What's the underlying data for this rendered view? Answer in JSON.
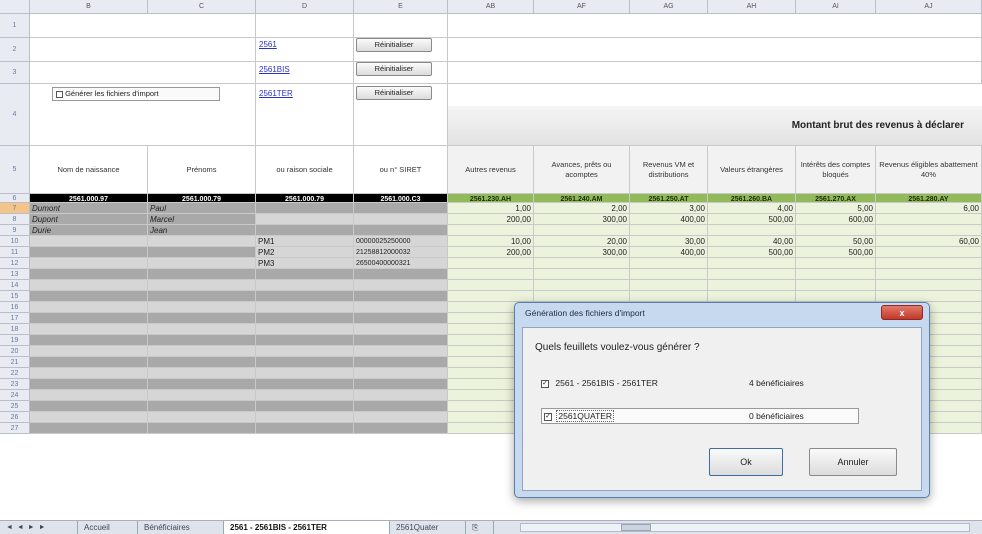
{
  "col_headers": [
    "B",
    "C",
    "D",
    "E",
    "AB",
    "AF",
    "AG",
    "AH",
    "AI",
    "AJ"
  ],
  "row_numbers": [
    "1",
    "2",
    "3",
    "4",
    "5",
    "6",
    "7",
    "8",
    "9",
    "10",
    "11",
    "12",
    "13",
    "14",
    "15",
    "16",
    "17",
    "18",
    "19",
    "20",
    "21",
    "22",
    "23",
    "24",
    "25",
    "26",
    "27"
  ],
  "top": {
    "link1": "2561",
    "link2": "2561BIS",
    "link3": "2561TER",
    "btn1": "Réinitialiser",
    "btn2": "Réinitialiser",
    "btn3": "Réinitialiser",
    "checkbox_label": "Générer les fichiers d'import",
    "montant_title": "Montant brut des revenus à déclarer"
  },
  "columns": {
    "c1": "Nom de naissance",
    "c2": "Prénoms",
    "c3": "ou raison sociale",
    "c4": "ou n° SIRET",
    "c5": "Autres revenus",
    "c6": "Avances, prêts ou acomptes",
    "c7": "Revenus VM et distributions",
    "c8": "Valeurs étrangères",
    "c9": "Intérêts des comptes bloqués",
    "c10": "Revenus éligibles abattement 40%"
  },
  "totals": [
    "2561.000.97",
    "2561.000.79",
    "2561.000.79",
    "2561.000.C3",
    "2561.230.AH",
    "2561.240.AM",
    "2561.250.AT",
    "2561.260.BA",
    "2561.270.AX",
    "2561.280.AY"
  ],
  "rows": [
    {
      "nom": "Dumont",
      "prenom": "Paul",
      "raison": "",
      "siret": "",
      "v": [
        "1,00",
        "2,00",
        "3,00",
        "4,00",
        "5,00",
        "6,00"
      ]
    },
    {
      "nom": "Dupont",
      "prenom": "Marcel",
      "raison": "",
      "siret": "",
      "v": [
        "200,00",
        "300,00",
        "400,00",
        "500,00",
        "600,00",
        ""
      ]
    },
    {
      "nom": "Durie",
      "prenom": "Jean",
      "raison": "",
      "siret": "",
      "v": [
        "",
        "",
        "",
        "",
        "",
        ""
      ]
    },
    {
      "nom": "",
      "prenom": "",
      "raison": "PM1",
      "siret": "00000025250000",
      "v": [
        "10,00",
        "20,00",
        "30,00",
        "40,00",
        "50,00",
        "60,00"
      ]
    },
    {
      "nom": "",
      "prenom": "",
      "raison": "PM2",
      "siret": "21258812000032",
      "v": [
        "200,00",
        "300,00",
        "400,00",
        "500,00",
        "500,00",
        ""
      ]
    },
    {
      "nom": "",
      "prenom": "",
      "raison": "PM3",
      "siret": "26500400000321",
      "v": [
        "",
        "",
        "",
        "",
        "",
        ""
      ]
    }
  ],
  "dialog": {
    "title": "Génération des fichiers d'import",
    "question": "Quels feuillets voulez-vous générer ?",
    "option1_label": "2561 - 2561BIS - 2561TER",
    "option1_count": "4 bénéficiaires",
    "option2_label": "2561QUATER",
    "option2_count": "0 bénéficiaires",
    "ok": "Ok",
    "cancel": "Annuler",
    "close": "x"
  },
  "tabs": {
    "nav": "◄ ◄ ► ►",
    "t1": "Accueil",
    "t2": "Bénéficiaires",
    "t3": "2561 - 2561BIS - 2561TER",
    "t4": "2561Quater",
    "t5": "⎘"
  },
  "colors": {
    "total_black": "#000000",
    "total_green": "#92b95a",
    "data_green": "#ebf3dc",
    "gray_row": "#a9a9a9",
    "dialog_close": "#c94a3d"
  }
}
